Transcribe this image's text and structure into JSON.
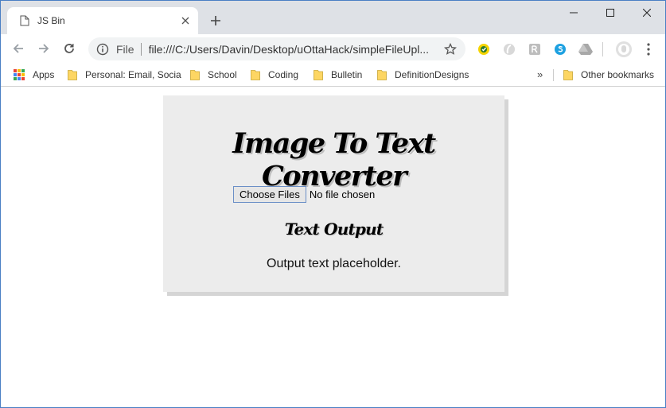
{
  "window": {
    "tab_title": "JS Bin",
    "controls": {
      "minimize": "minimize",
      "maximize": "maximize",
      "close": "close"
    }
  },
  "toolbar": {
    "scheme_label": "File",
    "url": "file:///C:/Users/Davin/Desktop/uOttaHack/simpleFileUpl...",
    "extensions": [
      "norton-icon",
      "ghostery-icon",
      "reader-icon",
      "skype-icon",
      "drive-icon"
    ]
  },
  "bookmarks": {
    "apps": "Apps",
    "items": [
      "Personal: Email, Socia",
      "School",
      "Coding",
      "Bulletin",
      "DefinitionDesigns"
    ],
    "overflow": "»",
    "other": "Other bookmarks",
    "folder_color": "#fdd663",
    "apps_colors": [
      "#ea4335",
      "#fbbc04",
      "#34a853",
      "#4285f4",
      "#ea4335",
      "#fbbc04",
      "#34a853",
      "#4285f4",
      "#ea4335"
    ]
  },
  "page": {
    "heading": "Image To Text Converter",
    "choose_button": "Choose Files",
    "file_status": "No file chosen",
    "output_heading": "Text Output",
    "output_text": "Output text placeholder."
  }
}
